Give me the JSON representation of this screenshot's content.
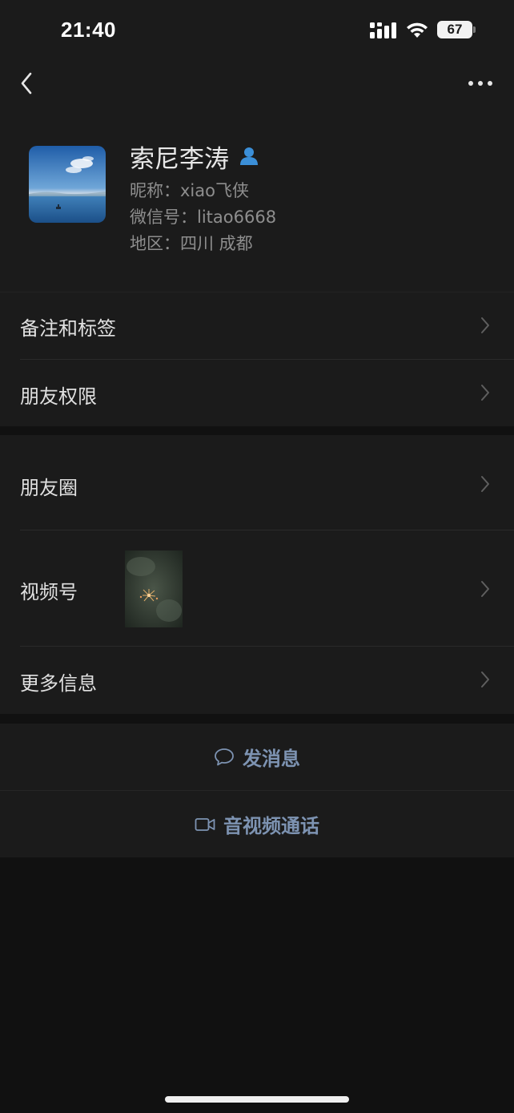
{
  "status_bar": {
    "time": "21:40",
    "battery": "67",
    "icons": [
      "signal-icon",
      "wifi-icon",
      "battery-icon"
    ]
  },
  "nav": {
    "back_icon": "chevron-left-icon",
    "more_icon": "more-dots-icon"
  },
  "profile": {
    "name": "索尼李涛",
    "gender_icon": "male-user-icon",
    "nickname": "昵称：xiao飞侠",
    "wechat_id": "微信号：litao6668",
    "region": "地区：四川 成都"
  },
  "menu_section_1": [
    {
      "label": "备注和标签"
    },
    {
      "label": "朋友权限"
    }
  ],
  "menu_section_2": [
    {
      "label": "朋友圈"
    },
    {
      "label": "视频号"
    },
    {
      "label": "更多信息"
    }
  ],
  "actions": {
    "message": {
      "label": "发消息",
      "icon": "chat-bubble-icon"
    },
    "call": {
      "label": "音视频通话",
      "icon": "video-camera-icon"
    }
  },
  "colors": {
    "background": "#111111",
    "panel": "#1b1b1b",
    "action_text": "#7d93b2",
    "secondary_text": "#8e8e8e",
    "gender_icon": "#3b8fd8"
  }
}
